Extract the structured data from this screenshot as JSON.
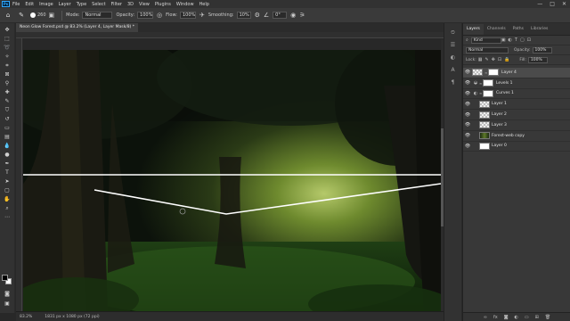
{
  "menubar": {
    "logo": "Ps",
    "items": [
      "File",
      "Edit",
      "Image",
      "Layer",
      "Type",
      "Select",
      "Filter",
      "3D",
      "View",
      "Plugins",
      "Window",
      "Help"
    ],
    "window_controls": [
      "—",
      "□",
      "✕"
    ]
  },
  "options": {
    "brush_size": "260",
    "mode_label": "Mode:",
    "mode_value": "Normal",
    "opacity_label": "Opacity:",
    "opacity_value": "100%",
    "flow_label": "Flow:",
    "flow_value": "100%",
    "smoothing_label": "Smoothing:",
    "smoothing_value": "10%",
    "angle_value": "0°"
  },
  "document": {
    "tab_title": "Neon Glow Forest.psd @ 83.2% (Layer 4, Layer Mask/8) *"
  },
  "status": {
    "zoom": "83.2%",
    "doc_size": "1831 px x 1080 px (72 ppi)"
  },
  "layers_panel": {
    "tabs": [
      "Layers",
      "Channels",
      "Paths",
      "Libraries"
    ],
    "filter_kind": "Kind",
    "blend_mode": "Normal",
    "opacity_label": "Opacity:",
    "opacity_value": "100%",
    "lock_label": "Lock:",
    "fill_label": "Fill:",
    "fill_value": "100%",
    "layers": [
      {
        "name": "Layer 4",
        "selected": true,
        "kind": "pixel-mask"
      },
      {
        "name": "Levels 1",
        "selected": false,
        "kind": "adjustment"
      },
      {
        "name": "Curves 1",
        "selected": false,
        "kind": "adjustment"
      },
      {
        "name": "Layer 1",
        "selected": false,
        "kind": "pixel"
      },
      {
        "name": "Layer 2",
        "selected": false,
        "kind": "pixel"
      },
      {
        "name": "Layer 3",
        "selected": false,
        "kind": "pixel"
      },
      {
        "name": "Forest-web copy",
        "selected": false,
        "kind": "image"
      },
      {
        "name": "Layer 0",
        "selected": false,
        "kind": "white"
      }
    ]
  },
  "colors": {
    "accent": "#31a8ff",
    "foreground": "#000000",
    "background": "#ffffff",
    "panel": "#383838"
  }
}
